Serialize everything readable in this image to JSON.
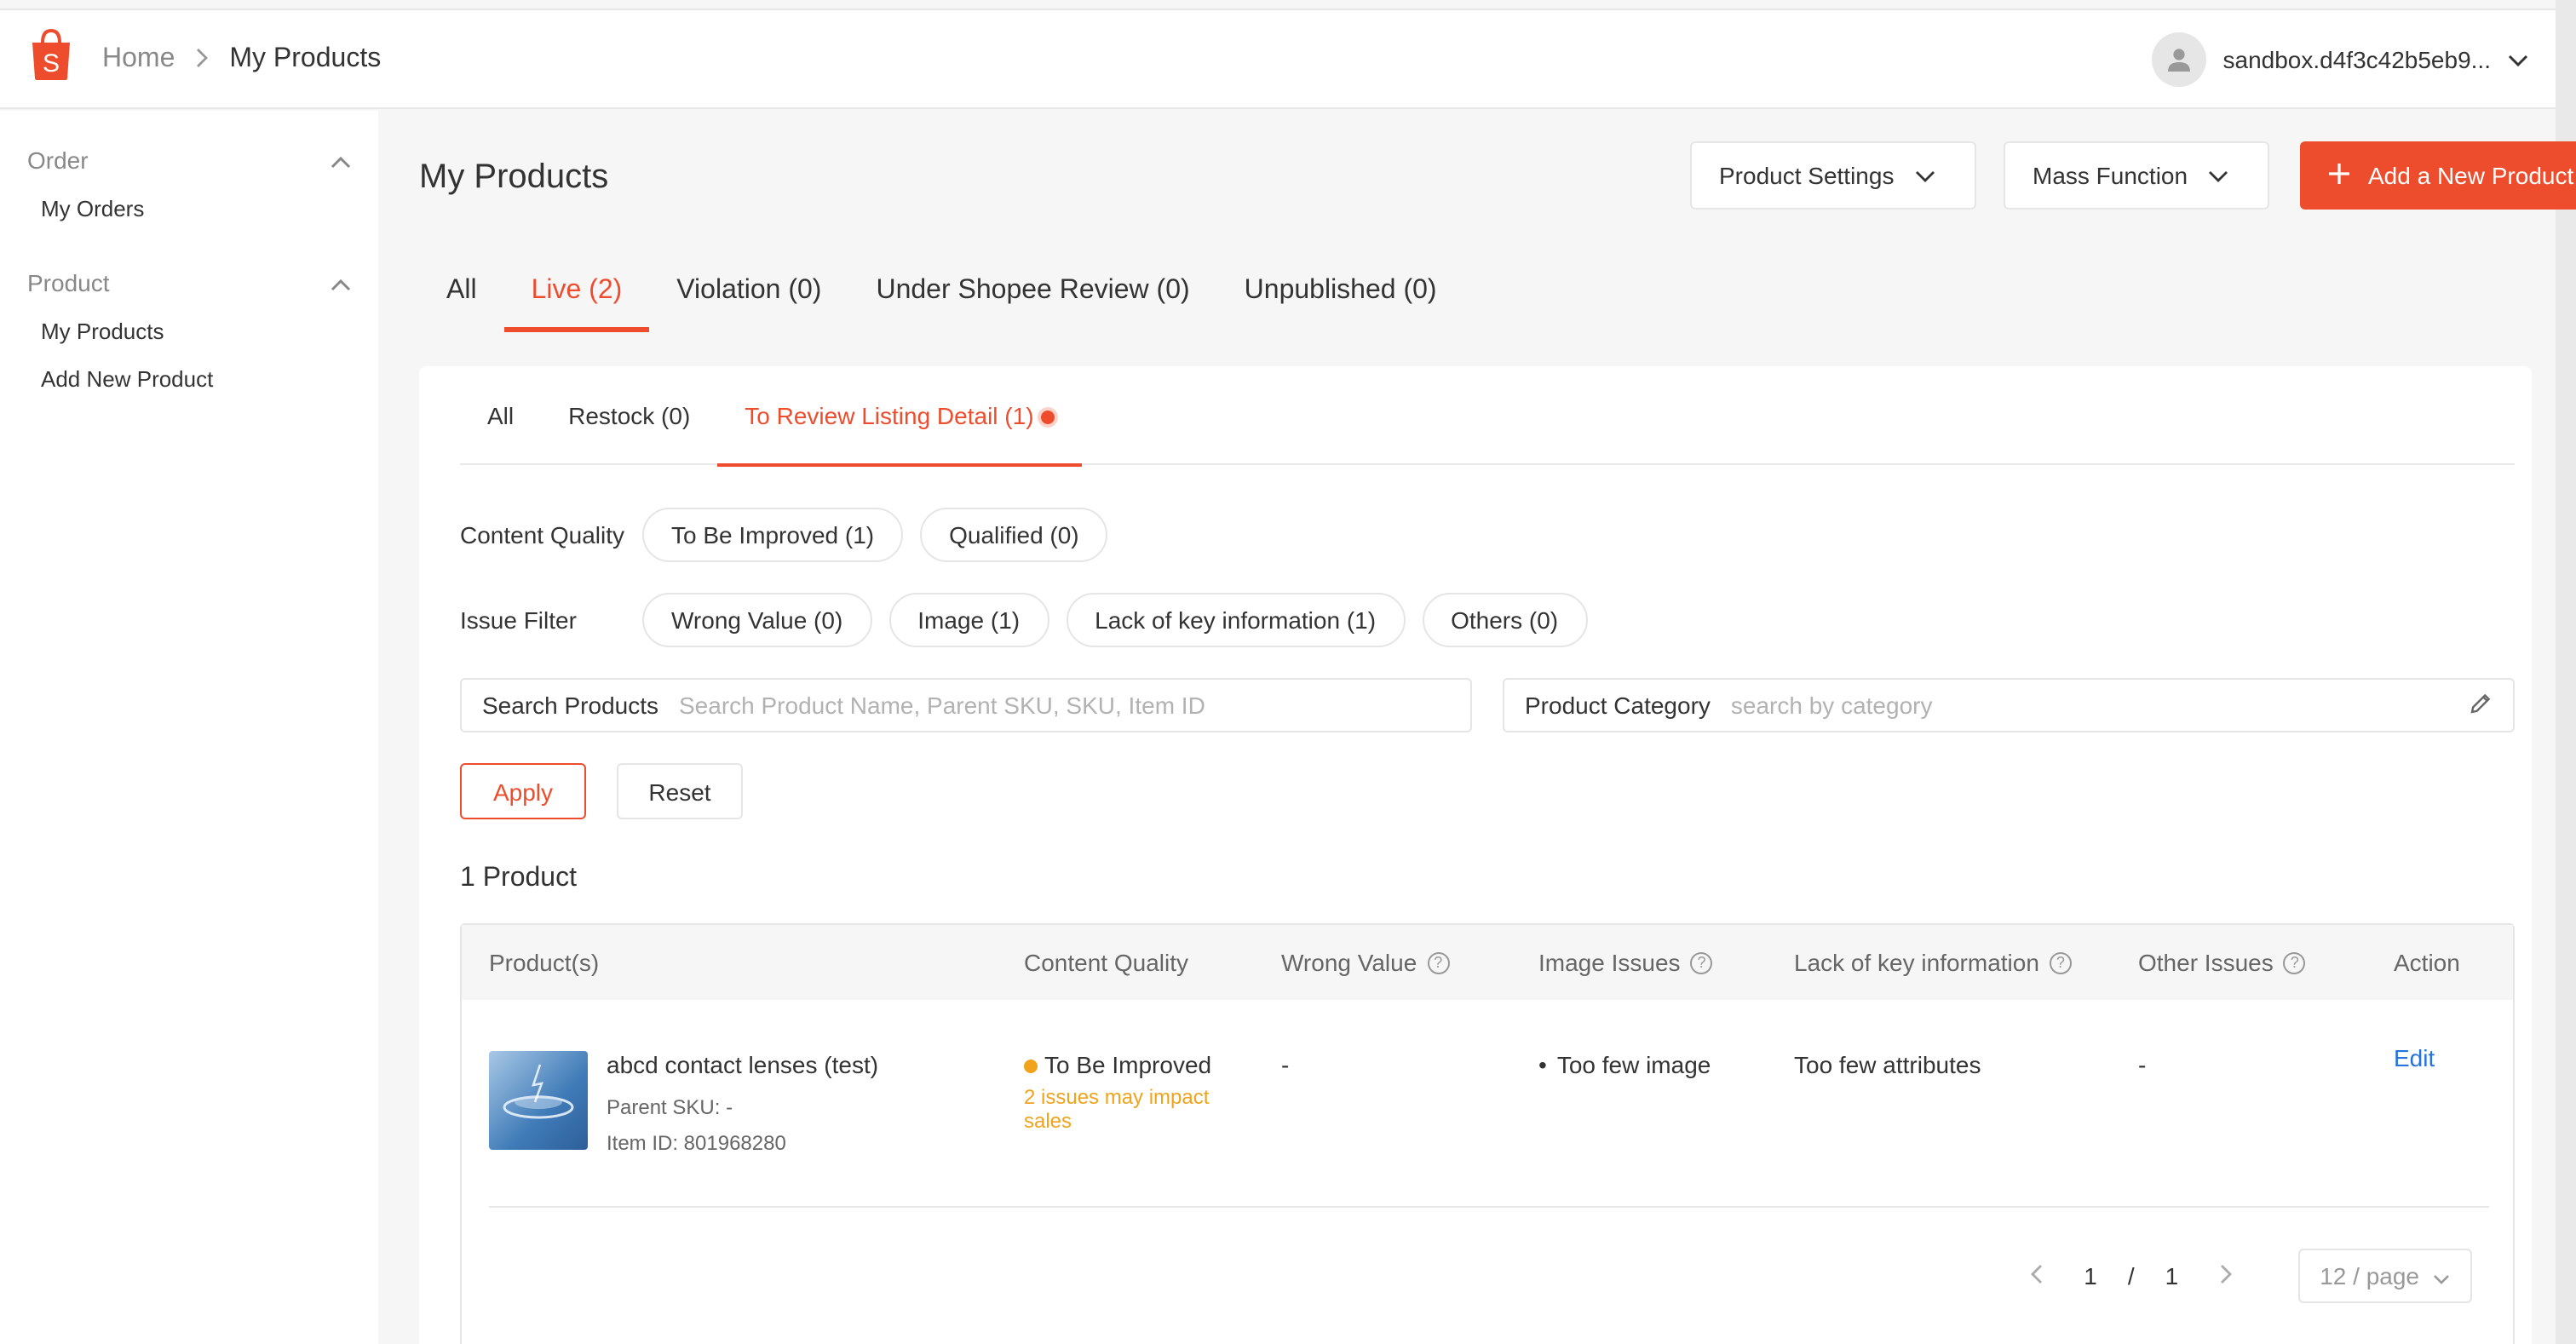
{
  "header": {
    "breadcrumb_home": "Home",
    "breadcrumb_separator": ">",
    "breadcrumb_current": "My Products",
    "account_name": "sandbox.d4f3c42b5eb9..."
  },
  "sidebar": {
    "groups": [
      {
        "title": "Order",
        "items": [
          {
            "label": "My Orders"
          }
        ]
      },
      {
        "title": "Product",
        "items": [
          {
            "label": "My Products"
          },
          {
            "label": "Add New Product"
          }
        ]
      }
    ]
  },
  "page": {
    "title": "My Products",
    "product_settings_label": "Product Settings",
    "mass_function_label": "Mass Function",
    "add_product_label": "Add a New Product"
  },
  "main_tabs": [
    {
      "label": "All"
    },
    {
      "label": "Live (2)",
      "active": true
    },
    {
      "label": "Violation (0)"
    },
    {
      "label": "Under Shopee Review (0)"
    },
    {
      "label": "Unpublished (0)"
    }
  ],
  "sub_tabs": [
    {
      "label": "All"
    },
    {
      "label": "Restock (0)"
    },
    {
      "label": "To Review Listing Detail (1)",
      "active": true
    }
  ],
  "filters": {
    "content_quality_label": "Content Quality",
    "content_quality_chips": [
      "To Be Improved (1)",
      "Qualified (0)"
    ],
    "issue_filter_label": "Issue Filter",
    "issue_chips": [
      "Wrong Value (0)",
      "Image (1)",
      "Lack of key information (1)",
      "Others (0)"
    ],
    "search_label": "Search Products",
    "search_placeholder": "Search Product Name, Parent SKU, SKU, Item ID",
    "category_label": "Product Category",
    "category_placeholder": "search by category",
    "apply_label": "Apply",
    "reset_label": "Reset"
  },
  "results": {
    "count_label": "1 Product"
  },
  "table": {
    "columns": [
      "Product(s)",
      "Content Quality",
      "Wrong Value",
      "Image Issues",
      "Lack of key information",
      "Other Issues",
      "Action"
    ],
    "rows": [
      {
        "name": "abcd contact lenses (test)",
        "parent_sku": "Parent SKU: -",
        "item_id": "Item ID: 801968280",
        "quality": "To Be Improved",
        "quality_note": "2 issues may impact sales",
        "wrong_value": "-",
        "image_issue": "Too few image",
        "lack_info": "Too few attributes",
        "other_issues": "-",
        "action": "Edit"
      }
    ]
  },
  "pagination": {
    "current": "1",
    "separator": "/",
    "total": "1",
    "per_page": "12 / page"
  },
  "colors": {
    "brand": "#ee4d2d",
    "warning": "#f0a31b",
    "link": "#2673dd"
  }
}
